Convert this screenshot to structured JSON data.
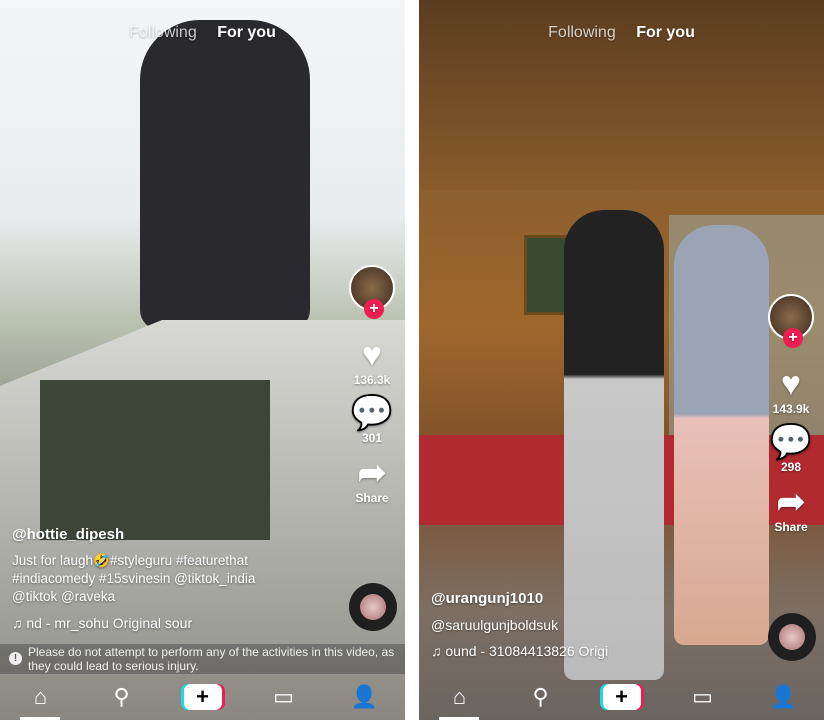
{
  "screens": [
    {
      "tabs": {
        "following": "Following",
        "for_you": "For you"
      },
      "likes": "136.3k",
      "comments": "301",
      "share_label": "Share",
      "username": "@hottie_dipesh",
      "description": "Just for laugh🤣#styleguru #featurethat #indiacomedy #15svinesin @tiktok_india @tiktok @raveka",
      "sound": "nd - mr_sohu    Original sour",
      "warning": "Please do not attempt to perform any of the activities in this video, as they could lead to serious injury."
    },
    {
      "tabs": {
        "following": "Following",
        "for_you": "For you"
      },
      "likes": "143.9k",
      "comments": "298",
      "share_label": "Share",
      "username": "@urangunj1010",
      "description": "@saruulgunjboldsuk",
      "sound": "ound - 31084413826    Origi"
    }
  ],
  "nav": {
    "home": "home-icon",
    "discover": "search-icon",
    "create": "+",
    "inbox": "inbox-icon",
    "me": "profile-icon"
  },
  "colors": {
    "accent": "#ee1d52",
    "cyan": "#20d5ec"
  }
}
